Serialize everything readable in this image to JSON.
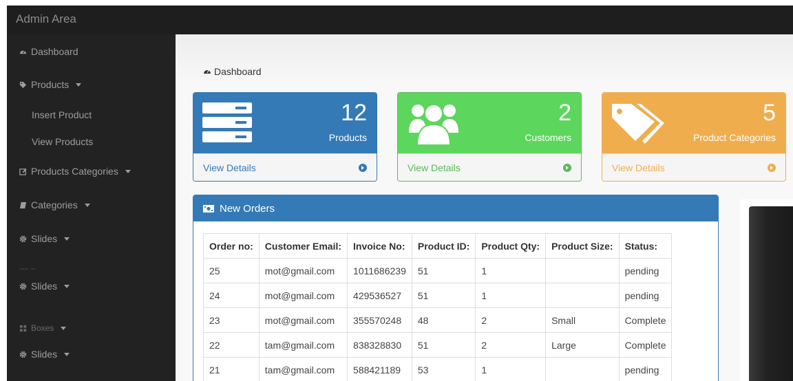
{
  "topbar": {
    "brand": "Admin Area"
  },
  "sidebar": {
    "items": [
      {
        "label": "Dashboard",
        "icon": "dashboard-icon"
      },
      {
        "label": "Products",
        "icon": "tag-icon"
      },
      {
        "label": "Insert Product"
      },
      {
        "label": "View Products"
      },
      {
        "label": "Products Categories",
        "icon": "edit-icon"
      },
      {
        "label": "Categories",
        "icon": "book-icon"
      },
      {
        "label": "Slides",
        "icon": "gear-icon"
      },
      {
        "label": "Slides",
        "icon": "gear-icon"
      },
      {
        "label": "Boxes",
        "icon": "boxes-icon"
      },
      {
        "label": "Slides",
        "icon": "gear-icon"
      }
    ]
  },
  "breadcrumb": {
    "label": "Dashboard",
    "icon": "dashboard-icon"
  },
  "panels": [
    {
      "count": "12",
      "label": "Products",
      "link": "View Details",
      "color": "#337ab7",
      "icon": "server-icon"
    },
    {
      "count": "2",
      "label": "Customers",
      "link": "View Details",
      "color": "#5cb85c",
      "icon": "users-icon"
    },
    {
      "count": "5",
      "label": "Product Categories",
      "link": "View Details",
      "color": "#f0ad4e",
      "icon": "tags-icon"
    }
  ],
  "orders": {
    "title": "New Orders",
    "columns": [
      "Order no:",
      "Customer Email:",
      "Invoice No:",
      "Product ID:",
      "Product Qty:",
      "Product Size:",
      "Status:"
    ],
    "rows": [
      [
        "25",
        "mot@gmail.com",
        "1011686239",
        "51",
        "1",
        "",
        "pending"
      ],
      [
        "24",
        "mot@gmail.com",
        "429536527",
        "51",
        "1",
        "",
        "pending"
      ],
      [
        "23",
        "mot@gmail.com",
        "355570248",
        "48",
        "2",
        "Small",
        "Complete"
      ],
      [
        "22",
        "tam@gmail.com",
        "838328830",
        "51",
        "2",
        "Large",
        "Complete"
      ],
      [
        "21",
        "tam@gmail.com",
        "588421189",
        "53",
        "1",
        "",
        "pending"
      ]
    ]
  }
}
